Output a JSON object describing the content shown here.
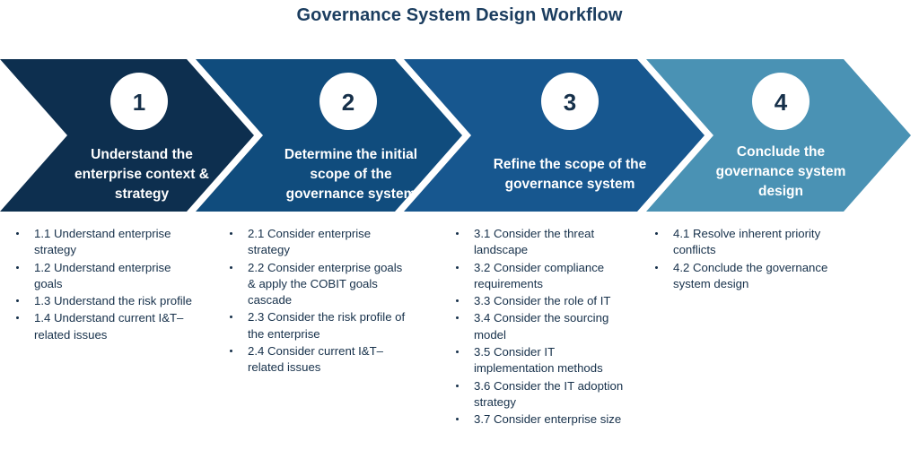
{
  "title": "Governance System Design Workflow",
  "colors": {
    "step1": "#0d2f4f",
    "step2": "#104c7d",
    "step3": "#17578f",
    "step4": "#4a92b4",
    "title_text": "#1b3d5f",
    "body_text": "#16304a",
    "circle_fill": "#ffffff",
    "background": "#ffffff"
  },
  "steps": [
    {
      "number": "1",
      "title_lines": [
        "Understand the",
        "enterprise context &",
        "strategy"
      ],
      "bullets": [
        "1.1 Understand enterprise strategy",
        "1.2 Understand enterprise goals",
        "1.3 Understand the risk profile",
        "1.4 Understand current I&T–related issues"
      ]
    },
    {
      "number": "2",
      "title_lines": [
        "Determine the initial",
        "scope of the",
        "governance system"
      ],
      "bullets": [
        "2.1 Consider enterprise strategy",
        "2.2 Consider enterprise goals & apply the COBIT goals cascade",
        "2.3 Consider the risk profile of the enterprise",
        "2.4 Consider current I&T–related issues"
      ]
    },
    {
      "number": "3",
      "title_lines": [
        "Refine the scope of the",
        "governance system"
      ],
      "bullets": [
        "3.1 Consider the threat landscape",
        "3.2 Consider compliance requirements",
        "3.3 Consider the role of IT",
        "3.4 Consider the sourcing model",
        "3.5 Consider IT implementation methods",
        "3.6 Consider the IT adoption strategy",
        "3.7 Consider enterprise size"
      ]
    },
    {
      "number": "4",
      "title_lines": [
        "Conclude the",
        "governance system",
        "design"
      ],
      "bullets": [
        "4.1 Resolve inherent priority conflicts",
        "4.2 Conclude the governance system design"
      ]
    }
  ]
}
